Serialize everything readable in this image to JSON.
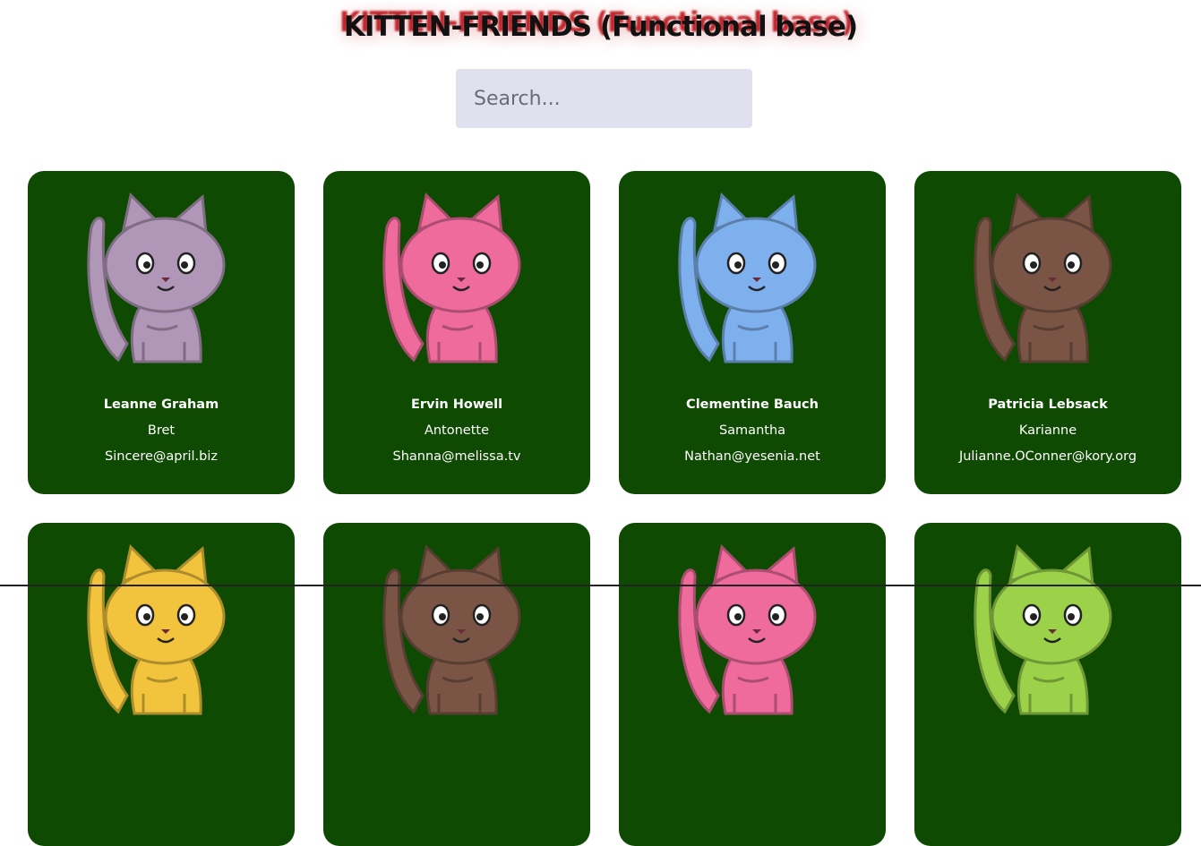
{
  "header": {
    "title": "KITTEN-FRIENDS (Functional base)"
  },
  "search": {
    "placeholder": "Search...",
    "value": ""
  },
  "cards": [
    {
      "name": "Leanne Graham",
      "username": "Bret",
      "email": "Sincere@april.biz",
      "color": "#b097b7"
    },
    {
      "name": "Ervin Howell",
      "username": "Antonette",
      "email": "Shanna@melissa.tv",
      "color": "#ee6b9b"
    },
    {
      "name": "Clementine Bauch",
      "username": "Samantha",
      "email": "Nathan@yesenia.net",
      "color": "#7fb0ee"
    },
    {
      "name": "Patricia Lebsack",
      "username": "Karianne",
      "email": "Julianne.OConner@kory.org",
      "color": "#7a5546"
    },
    {
      "name": "",
      "username": "",
      "email": "",
      "color": "#f2c43d"
    },
    {
      "name": "",
      "username": "",
      "email": "",
      "color": "#7a5546"
    },
    {
      "name": "",
      "username": "",
      "email": "",
      "color": "#ee6b9b"
    },
    {
      "name": "",
      "username": "",
      "email": "",
      "color": "#9bd24a"
    }
  ]
}
